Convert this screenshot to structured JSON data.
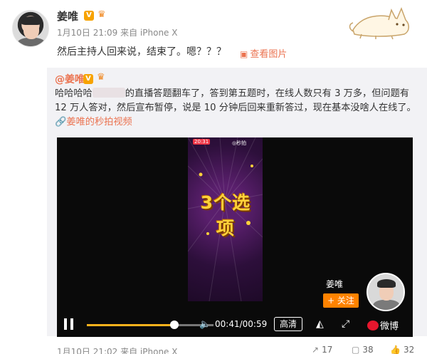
{
  "post": {
    "author": "姜唯",
    "verified_badge": "V",
    "meta": "1月10日 21:09 来自 iPhone X",
    "text": "然后主持人回来说，结束了。嗯？？？",
    "view_images": "查看图片"
  },
  "repost": {
    "author": "@姜唯",
    "text_before": "哈哈哈哈",
    "text_after": "的直播答题翻车了，答到第五题时，在线人数只有 3 万多，但问题有 12 万人答对，然后宣布暂停，说是 10 分钟后回来重新答过，现在基本没啥人在线了。",
    "link_icon": "🔗",
    "link_text": "姜唯的秒拍视频",
    "video": {
      "frame_text": "3个选项",
      "frame_tag": "20:31",
      "frame_logo": "◎秒拍",
      "author": "姜唯",
      "follow_label": "+ 关注",
      "progress": 0.69,
      "time": "00:41/00:59",
      "quality": "高清",
      "brand": "微博"
    },
    "footer": {
      "meta": "1月10日 21:02 来自 iPhone X",
      "share_count": "17",
      "comment_count": "38",
      "like_count": "32"
    }
  },
  "colors": {
    "accent": "#eb7350",
    "follow": "#ff8200",
    "progress": "#ffb21c"
  }
}
